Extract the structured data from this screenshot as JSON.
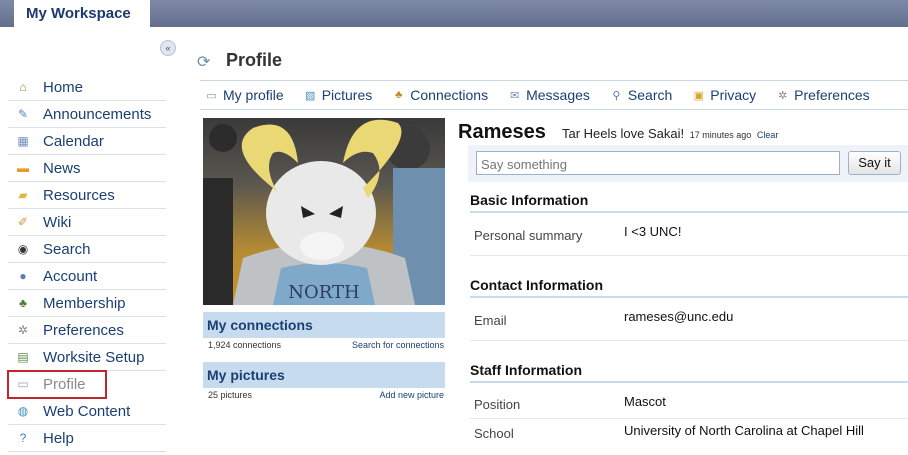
{
  "workspace_tab": "My Workspace",
  "collapse_glyph": "«",
  "sidebar": {
    "items": [
      {
        "label": "Home",
        "icon": "home-icon",
        "glyph": "⌂",
        "color": "#7a9a3a"
      },
      {
        "label": "Announcements",
        "icon": "announcements-icon",
        "glyph": "✎",
        "color": "#5b86c4"
      },
      {
        "label": "Calendar",
        "icon": "calendar-icon",
        "glyph": "▦",
        "color": "#6e8fb8"
      },
      {
        "label": "News",
        "icon": "news-icon",
        "glyph": "▬",
        "color": "#e39b2c"
      },
      {
        "label": "Resources",
        "icon": "folder-icon",
        "glyph": "▰",
        "color": "#e0b63f"
      },
      {
        "label": "Wiki",
        "icon": "wiki-icon",
        "glyph": "✐",
        "color": "#c99a3a"
      },
      {
        "label": "Search",
        "icon": "binoculars-icon",
        "glyph": "◉",
        "color": "#333333"
      },
      {
        "label": "Account",
        "icon": "account-icon",
        "glyph": "●",
        "color": "#5b7ab8"
      },
      {
        "label": "Membership",
        "icon": "membership-icon",
        "glyph": "♣",
        "color": "#4f7a3a"
      },
      {
        "label": "Preferences",
        "icon": "preferences-icon",
        "glyph": "✲",
        "color": "#888888"
      },
      {
        "label": "Worksite Setup",
        "icon": "worksite-setup-icon",
        "glyph": "▤",
        "color": "#5a8a4a"
      },
      {
        "label": "Profile",
        "icon": "profile-icon",
        "glyph": "▭",
        "color": "#9aa4b0"
      },
      {
        "label": "Web Content",
        "icon": "globe-icon",
        "glyph": "◍",
        "color": "#3f8fb8"
      },
      {
        "label": "Help",
        "icon": "help-icon",
        "glyph": "?",
        "color": "#4a7ab8"
      }
    ],
    "active_index": 11
  },
  "page": {
    "title": "Profile",
    "title_icon": "refresh-icon",
    "title_glyph": "⟳"
  },
  "toolbar": {
    "items": [
      {
        "label": "My profile",
        "icon": "my-profile-icon",
        "glyph": "▭",
        "color": "#8796a8"
      },
      {
        "label": "Pictures",
        "icon": "pictures-icon",
        "glyph": "▧",
        "color": "#4c8fb0"
      },
      {
        "label": "Connections",
        "icon": "connections-icon",
        "glyph": "♣",
        "color": "#c08a2a"
      },
      {
        "label": "Messages",
        "icon": "messages-icon",
        "glyph": "✉",
        "color": "#6e8fb8"
      },
      {
        "label": "Search",
        "icon": "search-icon",
        "glyph": "⚲",
        "color": "#5b7ab8"
      },
      {
        "label": "Privacy",
        "icon": "lock-icon",
        "glyph": "▣",
        "color": "#d6a52a"
      },
      {
        "label": "Preferences",
        "icon": "preferences-icon",
        "glyph": "✲",
        "color": "#888888"
      }
    ]
  },
  "connections_panel": {
    "heading": "My connections",
    "count": "1,924 connections",
    "link": "Search for connections"
  },
  "pictures_panel": {
    "heading": "My pictures",
    "count": "25 pictures",
    "link": "Add new picture"
  },
  "profile": {
    "name": "Rameses",
    "status": "Tar Heels love Sakai!",
    "status_time": "17 minutes ago",
    "clear_label": "Clear",
    "jersey_text": "NORTH"
  },
  "say_something": {
    "placeholder": "Say something",
    "button_label": "Say it"
  },
  "sections": {
    "basic": {
      "heading": "Basic Information",
      "rows": [
        {
          "label": "Personal summary",
          "value": "I <3 UNC!"
        }
      ]
    },
    "contact": {
      "heading": "Contact Information",
      "rows": [
        {
          "label": "Email",
          "value": "rameses@unc.edu"
        }
      ]
    },
    "staff": {
      "heading": "Staff Information",
      "rows": [
        {
          "label": "Position",
          "value": "Mascot"
        },
        {
          "label": "School",
          "value": "University of North Carolina at Chapel Hill"
        }
      ]
    }
  }
}
